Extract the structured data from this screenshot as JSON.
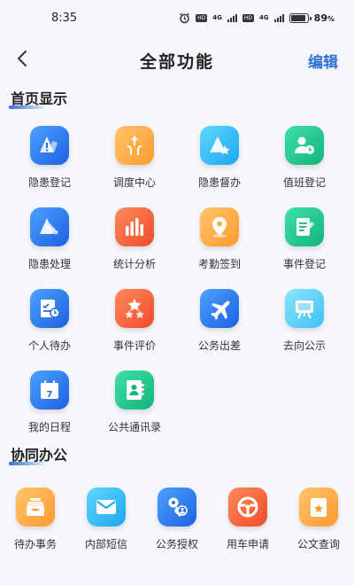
{
  "status_bar": {
    "time": "8:35",
    "battery": "89",
    "battery_unit": "%",
    "net1": "4G",
    "net2": "4G",
    "hd": "HD"
  },
  "nav": {
    "title": "全部功能",
    "edit_label": "编辑"
  },
  "sections": [
    {
      "title": "首页显示",
      "items": [
        {
          "label": "隐患登记",
          "icon": "hazard-register-icon",
          "color": "blue"
        },
        {
          "label": "调度中心",
          "icon": "dispatch-center-icon",
          "color": "orange"
        },
        {
          "label": "隐患督办",
          "icon": "hazard-supervise-icon",
          "color": "cyan"
        },
        {
          "label": "值班登记",
          "icon": "duty-register-icon",
          "color": "green"
        },
        {
          "label": "隐患处理",
          "icon": "hazard-handle-icon",
          "color": "blue"
        },
        {
          "label": "统计分析",
          "icon": "statistics-icon",
          "color": "red"
        },
        {
          "label": "考勤签到",
          "icon": "attendance-icon",
          "color": "orange"
        },
        {
          "label": "事件登记",
          "icon": "event-register-icon",
          "color": "green"
        },
        {
          "label": "个人待办",
          "icon": "personal-todo-icon",
          "color": "blue"
        },
        {
          "label": "事件评价",
          "icon": "event-rating-icon",
          "color": "red"
        },
        {
          "label": "公务出差",
          "icon": "business-trip-icon",
          "color": "blue"
        },
        {
          "label": "去向公示",
          "icon": "whereabouts-icon",
          "color": "sky"
        },
        {
          "label": "我的日程",
          "icon": "calendar-icon",
          "color": "blue",
          "badge": "7"
        },
        {
          "label": "公共通讯录",
          "icon": "contacts-icon",
          "color": "green"
        }
      ]
    },
    {
      "title": "协同办公",
      "items": [
        {
          "label": "待办事务",
          "icon": "pending-tasks-icon",
          "color": "orange"
        },
        {
          "label": "内部短信",
          "icon": "internal-sms-icon",
          "color": "cyan"
        },
        {
          "label": "公务授权",
          "icon": "authorization-icon",
          "color": "blue"
        },
        {
          "label": "用车申请",
          "icon": "vehicle-request-icon",
          "color": "red"
        },
        {
          "label": "公文查询",
          "icon": "document-query-icon",
          "color": "orange"
        }
      ]
    }
  ]
}
